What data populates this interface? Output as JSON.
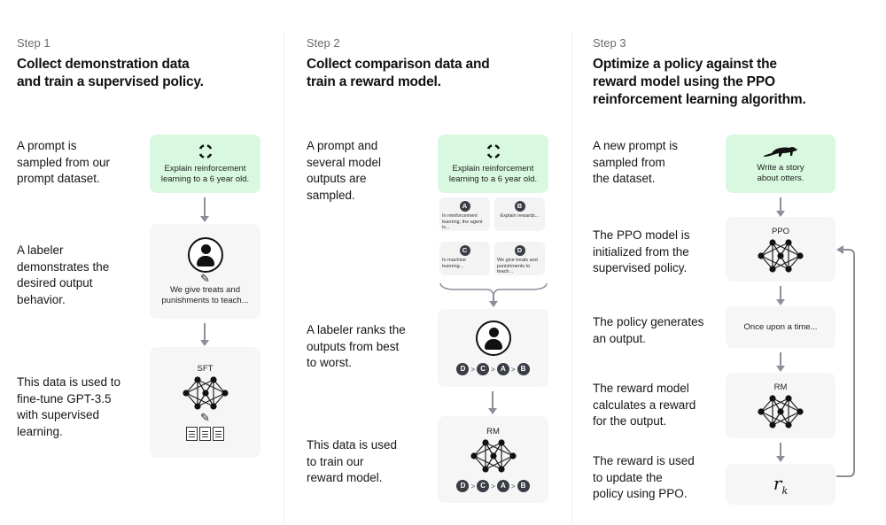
{
  "steps": [
    {
      "label": "Step 1",
      "title_lines": [
        "Collect demonstration data",
        "and train a supervised policy."
      ],
      "descriptions": [
        [
          "A prompt is",
          "sampled from our",
          "prompt dataset."
        ],
        [
          "A labeler",
          "demonstrates the",
          "desired output",
          "behavior."
        ],
        [
          "This data is used to",
          "fine-tune GPT-3.5",
          "with supervised",
          "learning."
        ]
      ],
      "prompt_box": {
        "icon": "refresh-cycle-icon",
        "lines": [
          "Explain reinforcement",
          "learning to a 6 year old."
        ]
      },
      "labeler_box": {
        "icon": "user-icon",
        "pencil_icon": "✎",
        "lines": [
          "We give treats and",
          "punishments to teach..."
        ]
      },
      "model_box": {
        "label": "SFT",
        "icon": "neural-network-icon",
        "pencil_icon": "✎",
        "docs_icon": "documents-icon"
      }
    },
    {
      "label": "Step 2",
      "title_lines": [
        "Collect comparison data and",
        "train a reward model."
      ],
      "descriptions": [
        [
          "A prompt and",
          "several model",
          "outputs are",
          "sampled."
        ],
        [
          "A labeler ranks the",
          "outputs from best",
          "to worst."
        ],
        [
          "This data is used",
          "to train our",
          "reward model."
        ]
      ],
      "prompt_box": {
        "icon": "refresh-cycle-icon",
        "lines": [
          "Explain reinforcement",
          "learning to a 6 year old."
        ]
      },
      "outputs": [
        {
          "letter": "A",
          "text": "In reinforcement learning, the agent is..."
        },
        {
          "letter": "B",
          "text": "Explain rewards..."
        },
        {
          "letter": "C",
          "text": "In machine learning..."
        },
        {
          "letter": "D",
          "text": "We give treats and punishments to teach..."
        }
      ],
      "ranking": [
        "D",
        "C",
        "A",
        "B"
      ],
      "ranking_separator": ">",
      "model_box": {
        "label": "RM",
        "icon": "neural-network-icon"
      }
    },
    {
      "label": "Step 3",
      "title_lines": [
        "Optimize a policy against the",
        "reward model using the PPO",
        "reinforcement learning algorithm."
      ],
      "descriptions": [
        [
          "A new prompt is",
          "sampled from",
          "the dataset."
        ],
        [
          "The PPO model is",
          "initialized from the",
          "supervised policy."
        ],
        [
          "The policy generates",
          "an output."
        ],
        [
          "The reward model",
          "calculates a reward",
          "for the output."
        ],
        [
          "The reward is used",
          "to update the",
          "policy using PPO."
        ]
      ],
      "prompt_box": {
        "icon": "otter-icon",
        "lines": [
          "Write a story",
          "about otters."
        ]
      },
      "policy_box": {
        "label": "PPO",
        "icon": "neural-network-icon"
      },
      "output_box": {
        "text": "Once upon a time..."
      },
      "reward_model_box": {
        "label": "RM",
        "icon": "neural-network-icon"
      },
      "reward_box": {
        "symbol": "r",
        "subscript": "k"
      }
    }
  ],
  "colors": {
    "prompt_box_bg": "#d8f8df",
    "box_bg": "#f6f6f6",
    "arrow": "#8a8f98",
    "badge": "#3a3d45"
  }
}
